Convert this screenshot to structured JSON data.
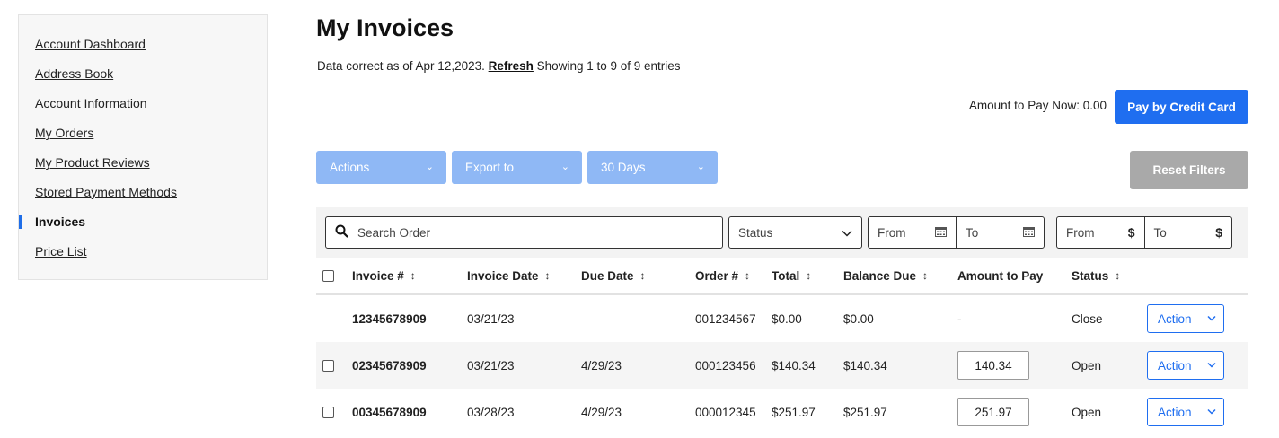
{
  "sidebar": {
    "items": [
      {
        "label": "Account Dashboard"
      },
      {
        "label": "Address Book"
      },
      {
        "label": "Account Information"
      },
      {
        "label": "My Orders"
      },
      {
        "label": "My Product Reviews"
      },
      {
        "label": "Stored Payment Methods"
      },
      {
        "label": "Invoices",
        "active": true
      },
      {
        "label": "Price List"
      }
    ]
  },
  "page": {
    "title": "My Invoices",
    "data_note": "Data correct as of Apr 12,2023.",
    "refresh_label": "Refresh",
    "entries_note": "Showing 1 to 9 of 9 entries",
    "amount_to_pay_now": "Amount to Pay Now: 0.00",
    "pay_button": "Pay by Credit Card",
    "accent_color": "#1f6ef0"
  },
  "toolbar": {
    "actions_label": "Actions",
    "export_label": "Export to",
    "range_label": "30 Days",
    "reset_label": "Reset Filters"
  },
  "filters": {
    "search_placeholder": "Search Order",
    "status_label": "Status",
    "date_from": "From",
    "date_to": "To",
    "amount_from": "From",
    "amount_to": "To"
  },
  "table": {
    "headers": {
      "invoice": "Invoice #",
      "invoice_date": "Invoice Date",
      "due_date": "Due Date",
      "order": "Order #",
      "total": "Total",
      "balance": "Balance Due",
      "amount": "Amount to Pay",
      "status": "Status"
    },
    "rows": [
      {
        "invoice": "12345678909",
        "invoice_date": "03/21/23",
        "due_date": "",
        "order": "001234567",
        "total": "$0.00",
        "balance": "$0.00",
        "amount": "-",
        "status": "Close",
        "action": "Action",
        "selectable": false
      },
      {
        "invoice": "02345678909",
        "invoice_date": "03/21/23",
        "due_date": "4/29/23",
        "order": "000123456",
        "total": "$140.34",
        "balance": "$140.34",
        "amount": "140.34",
        "status": "Open",
        "action": "Action",
        "selectable": true
      },
      {
        "invoice": "00345678909",
        "invoice_date": "03/28/23",
        "due_date": "4/29/23",
        "order": "000012345",
        "total": "$251.97",
        "balance": "$251.97",
        "amount": "251.97",
        "status": "Open",
        "action": "Action",
        "selectable": true
      }
    ]
  }
}
